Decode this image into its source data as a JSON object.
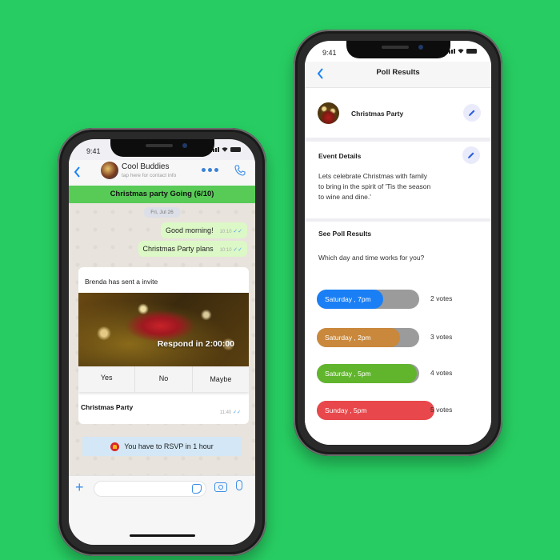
{
  "background_color": "#27cd62",
  "chat_phone": {
    "status_time": "9:41",
    "header": {
      "back_icon": "chevron-left-icon",
      "title": "Cool Buddies",
      "subtitle": "tap here for contact info",
      "more_icon": "more-dots-icon",
      "call_icon": "phone-icon"
    },
    "banner": "Christmas party   Going (6/10)",
    "date_label": "Fri, Jul 26",
    "messages": [
      {
        "text": "Good morning!",
        "time": "10:10",
        "status": "read"
      },
      {
        "text": "Christmas Party plans",
        "time": "10:10",
        "status": "read"
      }
    ],
    "invite": {
      "header": "Brenda has sent a invite",
      "countdown": "Respond in 2:00:00",
      "options": [
        "Yes",
        "No",
        "Maybe"
      ],
      "title": "Christmas Party",
      "time": "11:40"
    },
    "notice": {
      "icon": "bell-icon",
      "text": "You have to RSVP in 1 hour"
    },
    "input_bar": {
      "plus_icon": "plus-icon",
      "placeholder": "",
      "sticker_icon": "sticker-icon",
      "camera_icon": "camera-icon",
      "mic_icon": "microphone-icon"
    },
    "accent_color": "#3b8ee8",
    "banner_color": "#58cb57"
  },
  "poll_phone": {
    "status_time": "9:41",
    "header_title": "Poll Results",
    "event": {
      "name": "Christmas Party",
      "edit_icon": "pencil-icon"
    },
    "details": {
      "title": "Event Details",
      "text_lines": [
        "Lets celebrate Christmas with  family",
        "to bring in the spirit of  'Tis the season",
        "to wine and dine.'"
      ],
      "edit_icon": "pencil-icon"
    },
    "poll": {
      "title": "See Poll Results",
      "question": "Which day  and time works for you?",
      "max_votes": 6,
      "options": [
        {
          "label": "Saturday , 7pm",
          "votes": 2,
          "votes_label": "2 votes",
          "color": "#1a7ff5"
        },
        {
          "label": "Saturday , 2pm",
          "votes": 3,
          "votes_label": "3 votes",
          "color": "#c9883b"
        },
        {
          "label": "Saturday , 5pm",
          "votes": 4,
          "votes_label": "4 votes",
          "color": "#61b52d"
        },
        {
          "label": "Sunday , 5pm",
          "votes": 5,
          "votes_label": "5 votes",
          "color": "#e8474b"
        }
      ]
    }
  }
}
